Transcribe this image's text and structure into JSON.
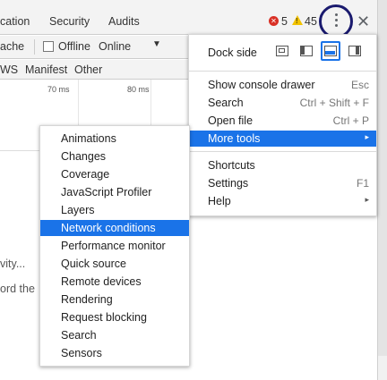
{
  "tabs": [
    "cation",
    "Security",
    "Audits"
  ],
  "status": {
    "errors": "5",
    "warnings": "45"
  },
  "toolbar": {
    "cache": "ache",
    "offline": "Offline",
    "online": "Online",
    "dropdown_arrow": "▼"
  },
  "filters": [
    "WS",
    "Manifest",
    "Other"
  ],
  "timeline": {
    "ticks": [
      "70 ms",
      "80 ms"
    ]
  },
  "background": {
    "line1": "vity...",
    "line2": "ord the"
  },
  "menu": {
    "dock_side_label": "Dock side",
    "items": [
      {
        "label": "Show console drawer",
        "shortcut": "Esc"
      },
      {
        "label": "Search",
        "shortcut": "Ctrl + Shift + F"
      },
      {
        "label": "Open file",
        "shortcut": "Ctrl + P"
      },
      {
        "label": "More tools",
        "arrow": "▸",
        "active": true
      },
      {
        "label": "Shortcuts",
        "shortcut": ""
      },
      {
        "label": "Settings",
        "shortcut": "F1"
      },
      {
        "label": "Help",
        "arrow": "▸"
      }
    ]
  },
  "submenu": {
    "items": [
      "Animations",
      "Changes",
      "Coverage",
      "JavaScript Profiler",
      "Layers",
      "Network conditions",
      "Performance monitor",
      "Quick source",
      "Remote devices",
      "Rendering",
      "Request blocking",
      "Search",
      "Sensors"
    ],
    "active_label": "Network conditions"
  },
  "colors": {
    "accent": "#1a73e8",
    "error": "#d93025",
    "warning": "#f2c300",
    "highlight_circle": "#1a1a6e"
  },
  "icons": {
    "error": "error-circle-icon",
    "warning": "warning-triangle-icon",
    "more": "kebab-menu-icon",
    "close": "close-icon"
  }
}
